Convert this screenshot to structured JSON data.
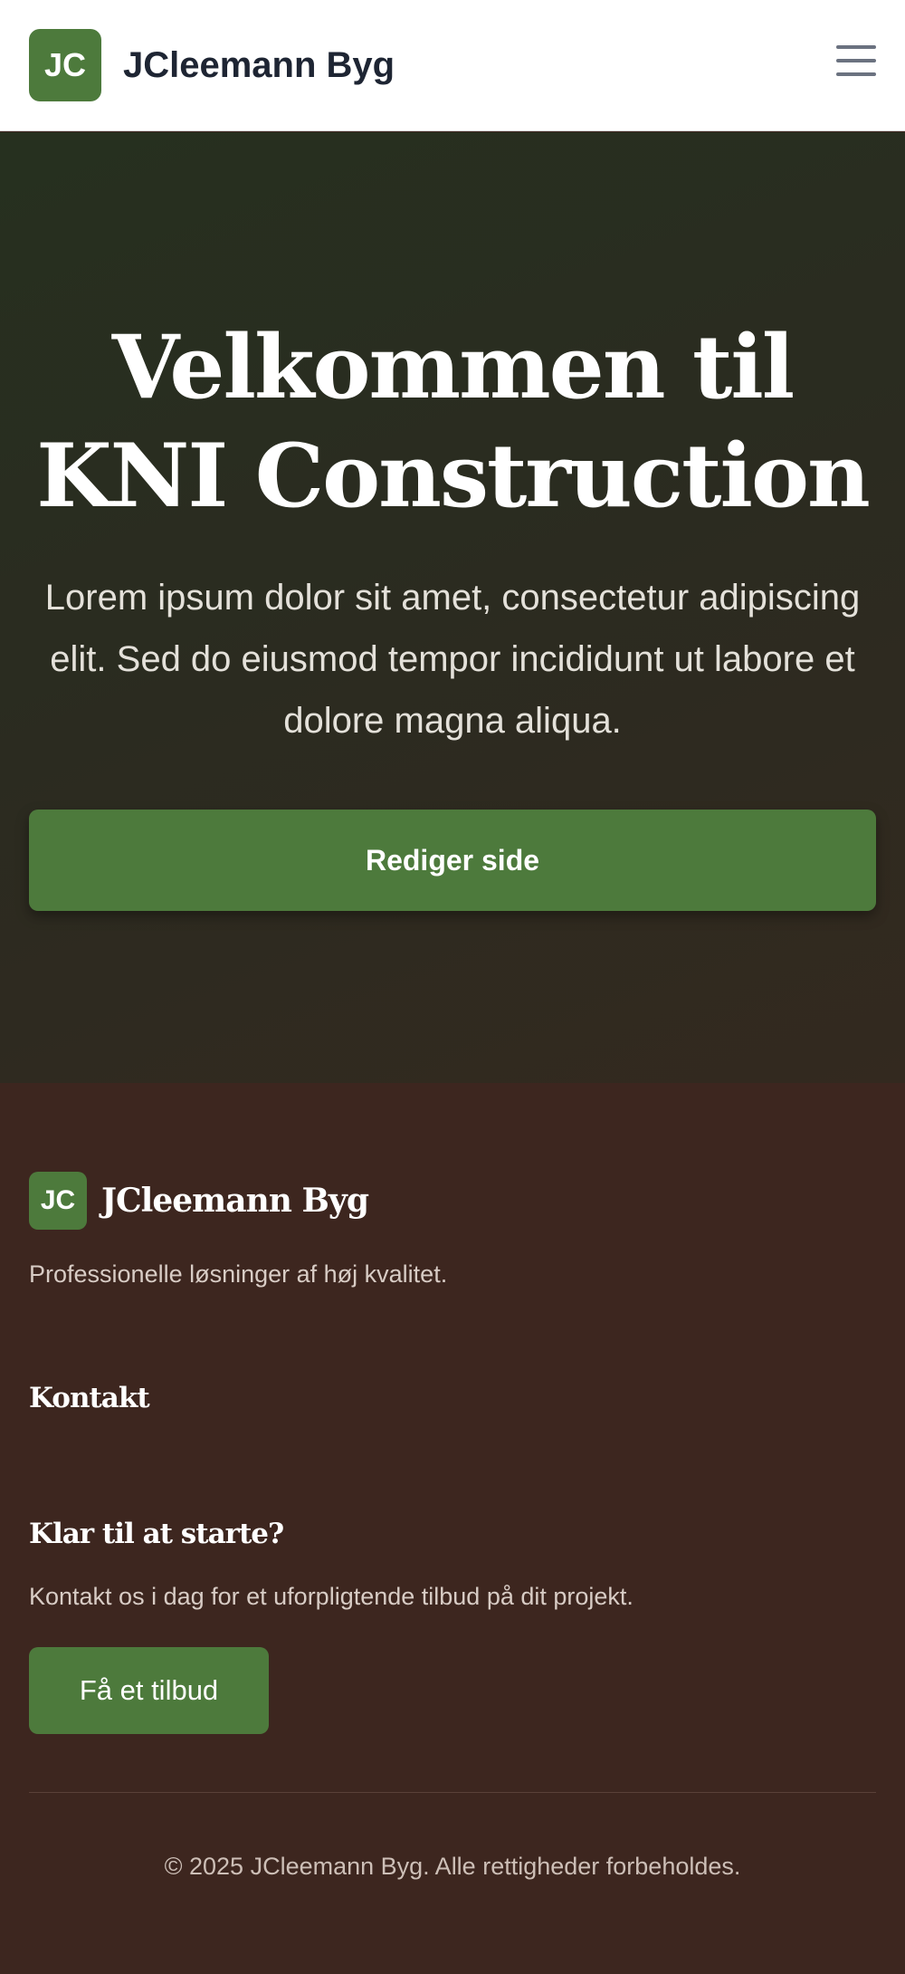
{
  "header": {
    "logo_initials": "JC",
    "brand_name": "JCleemann Byg",
    "menu_icon": "hamburger-menu-icon"
  },
  "hero": {
    "title": "Velkommen til KNI Construction",
    "text": "Lorem ipsum dolor sit amet, consectetur adipiscing elit. Sed do eiusmod tempor incididunt ut labore et dolore magna aliqua.",
    "button_label": "Rediger side"
  },
  "footer": {
    "logo_initials": "JC",
    "brand_name": "JCleemann Byg",
    "tagline": "Professionelle løsninger af høj kvalitet.",
    "contact_heading": "Kontakt",
    "cta_title": "Klar til at starte?",
    "cta_text": "Kontakt os i dag for et uforpligtende tilbud på dit projekt.",
    "cta_button": "Få et tilbud",
    "copyright": "© 2025 JCleemann Byg. Alle rettigheder forbeholdes."
  },
  "colors": {
    "accent": "#4d7a3c",
    "hero_bg": "#2b2b20",
    "footer_bg": "#3d261f",
    "header_text": "#1e2533"
  }
}
